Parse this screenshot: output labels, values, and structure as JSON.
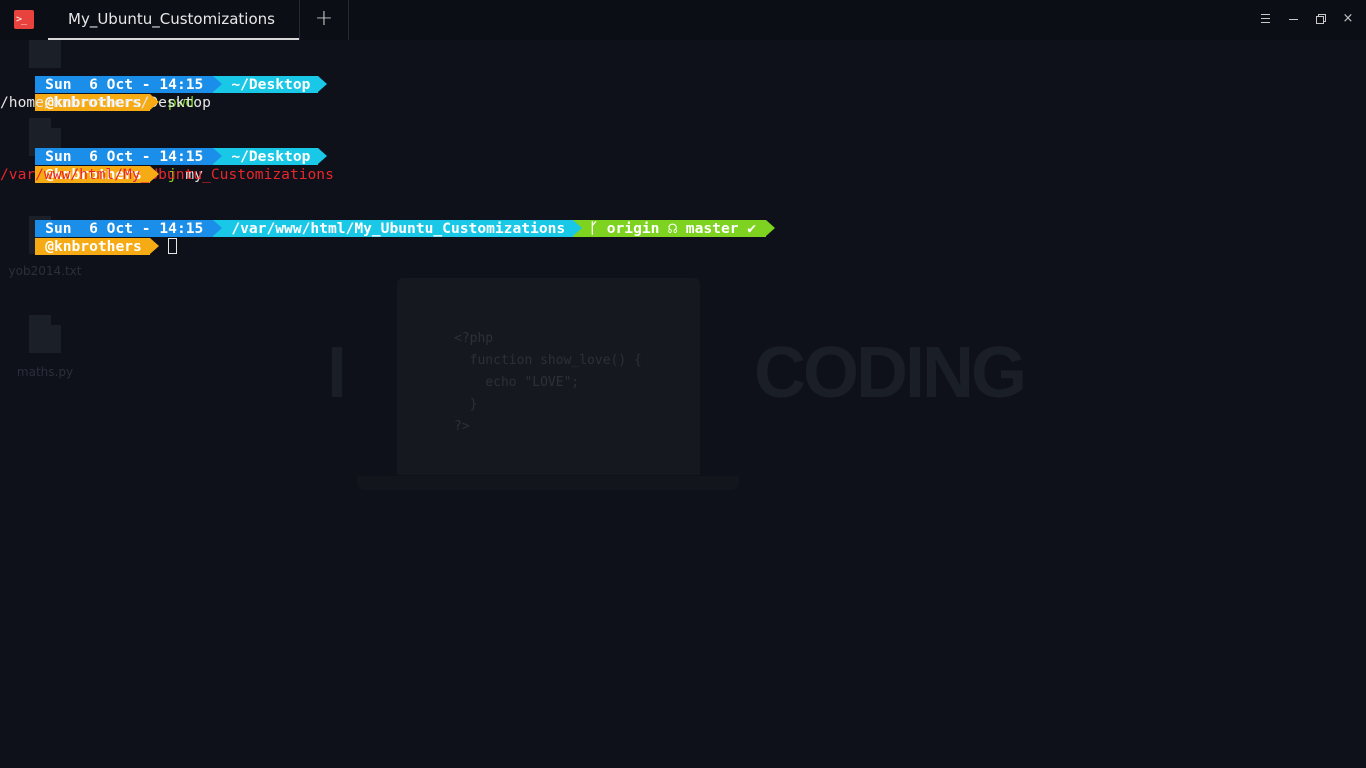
{
  "window": {
    "tab_title": "My_Ubuntu_Customizations",
    "new_tab_symbol": "+",
    "app_icon": "terminal-icon",
    "app_icon_glyph": ">_",
    "controls": [
      "menu-icon",
      "minimize-icon",
      "maximize-icon",
      "close-icon"
    ],
    "close_symbol": "×",
    "accent_color": "#e8423f"
  },
  "wallpaper": {
    "desktop_files": [
      "yob2014.txt",
      "maths.py"
    ],
    "code_lines": [
      "<?php",
      "  function show_love() {",
      "    echo \"LOVE\";",
      "  }",
      "?>"
    ],
    "big_text_left": "I",
    "big_text_right": "CODING"
  },
  "prompt": {
    "date": "Sun  6 Oct - 14:15",
    "user": "@knbrothers",
    "colors": {
      "date_bg": "#1a8ee8",
      "path_bg": "#19c7e6",
      "git_bg": "#7ed321",
      "user_bg": "#f6ab14"
    }
  },
  "session": [
    {
      "path": "~/Desktop",
      "command": "pwd",
      "args": "",
      "output": "/home/knbrothers/Desktop",
      "output_style": "normal"
    },
    {
      "path": "~/Desktop",
      "command": "j",
      "args": " my",
      "output": "/var/www/html/My_Ubuntu_Customizations",
      "output_style": "error-red"
    },
    {
      "path": "/var/www/html/My_Ubuntu_Customizations",
      "git": "ᚴ origin ☊ master ✔",
      "command": "",
      "args": "",
      "cursor": true
    }
  ]
}
